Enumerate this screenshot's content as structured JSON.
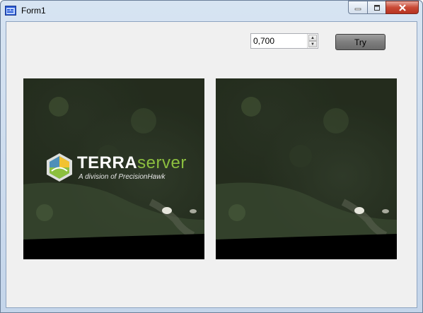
{
  "window": {
    "title": "Form1",
    "app_icon": "form-icon",
    "caption_icons": [
      "minimize-icon",
      "maximize-icon",
      "close-icon"
    ]
  },
  "toolbar": {
    "numeric_value": "0,700",
    "try_label": "Try"
  },
  "images": {
    "left": {
      "description_icon": "aerial-photo",
      "watermark": {
        "brand_part1": "TERRA",
        "brand_part2": "server",
        "tagline": "A division of PrecisionHawk"
      }
    },
    "right": {
      "description_icon": "aerial-photo"
    }
  },
  "colors": {
    "client_bg": "#f0f0f0",
    "brand_green": "#8cbf3f",
    "close_red": "#c94a36"
  }
}
